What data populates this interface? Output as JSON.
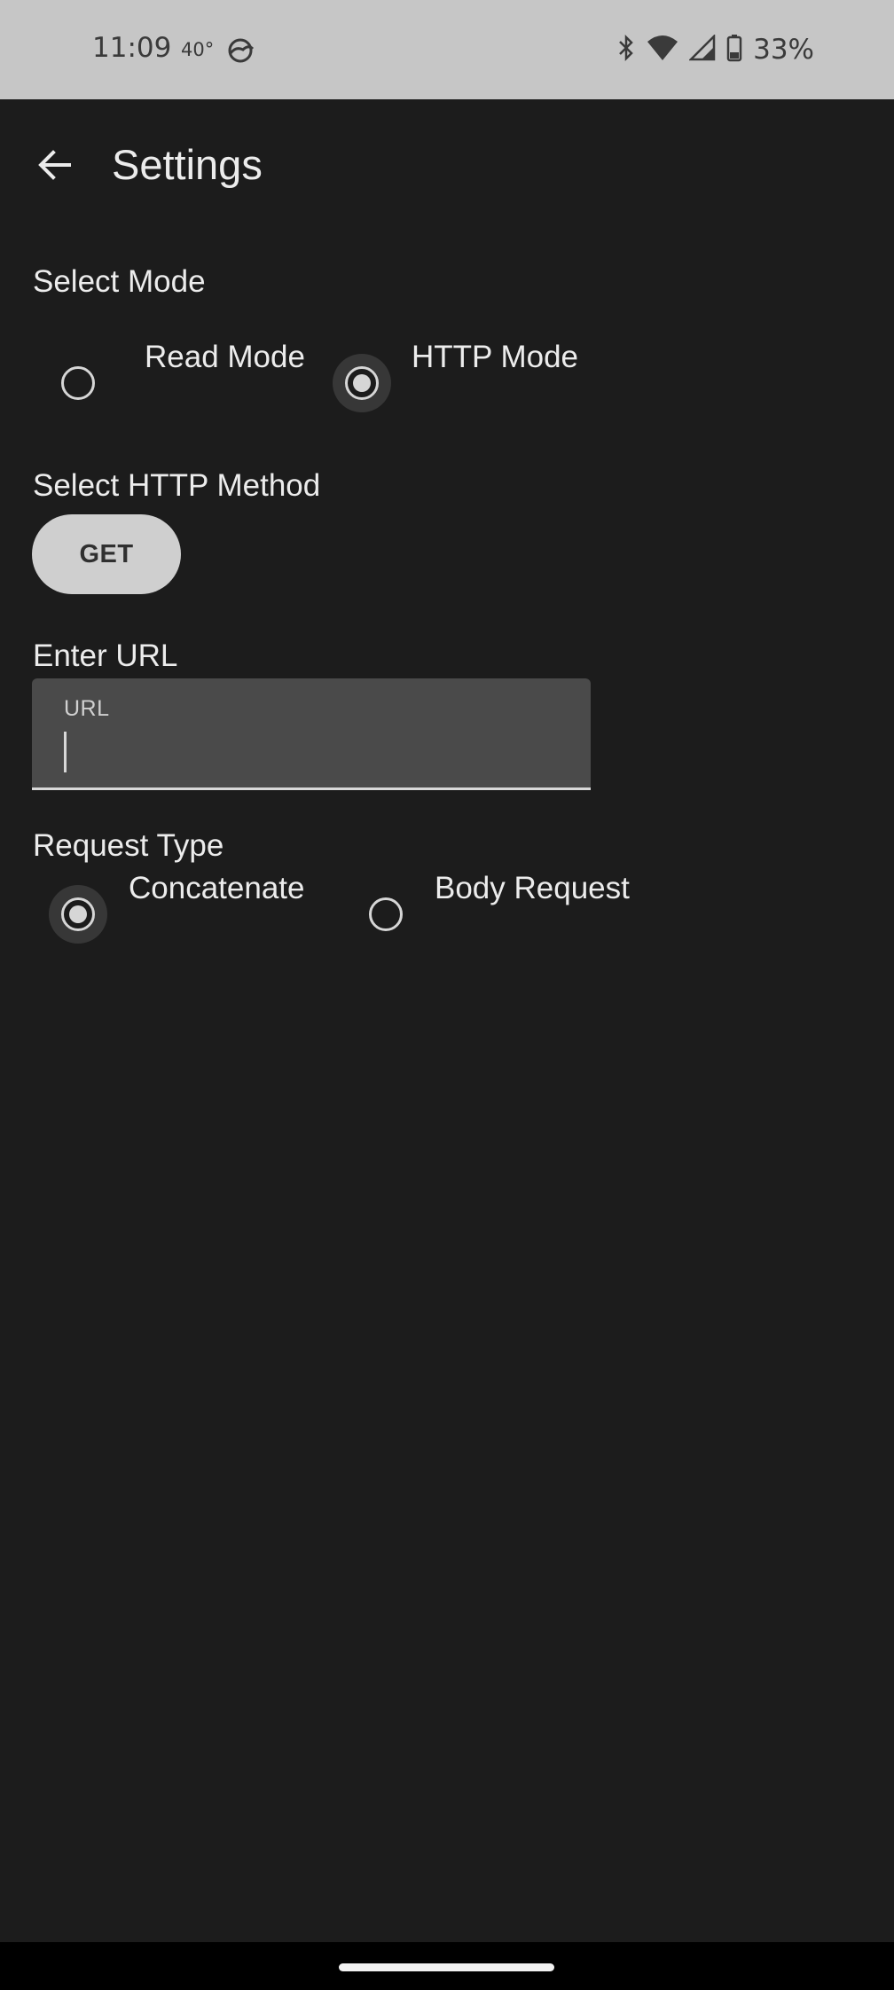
{
  "status_bar": {
    "time": "11:09",
    "temperature": "40°",
    "weather_icon": "cloudy-weather-icon",
    "icons": [
      "bluetooth-icon",
      "wifi-icon",
      "cell-signal-icon",
      "battery-icon"
    ],
    "battery": "33%"
  },
  "app_bar": {
    "back_icon": "arrow-back-icon",
    "title": "Settings"
  },
  "mode": {
    "label": "Select Mode",
    "options": [
      {
        "label": "Read Mode",
        "selected": false
      },
      {
        "label": "HTTP Mode",
        "selected": true
      }
    ]
  },
  "http_method": {
    "label": "Select HTTP Method",
    "value": "GET"
  },
  "url": {
    "label": "Enter URL",
    "field_label": "URL",
    "value": ""
  },
  "request_type": {
    "label": "Request Type",
    "options": [
      {
        "label": "Concatenate",
        "selected": true
      },
      {
        "label": "Body Request",
        "selected": false
      }
    ]
  },
  "colors": {
    "background": "#1c1c1c",
    "status_bar": "#c6c6c6",
    "accent": "#d6d6d6",
    "field_background": "#4a4a4a"
  }
}
